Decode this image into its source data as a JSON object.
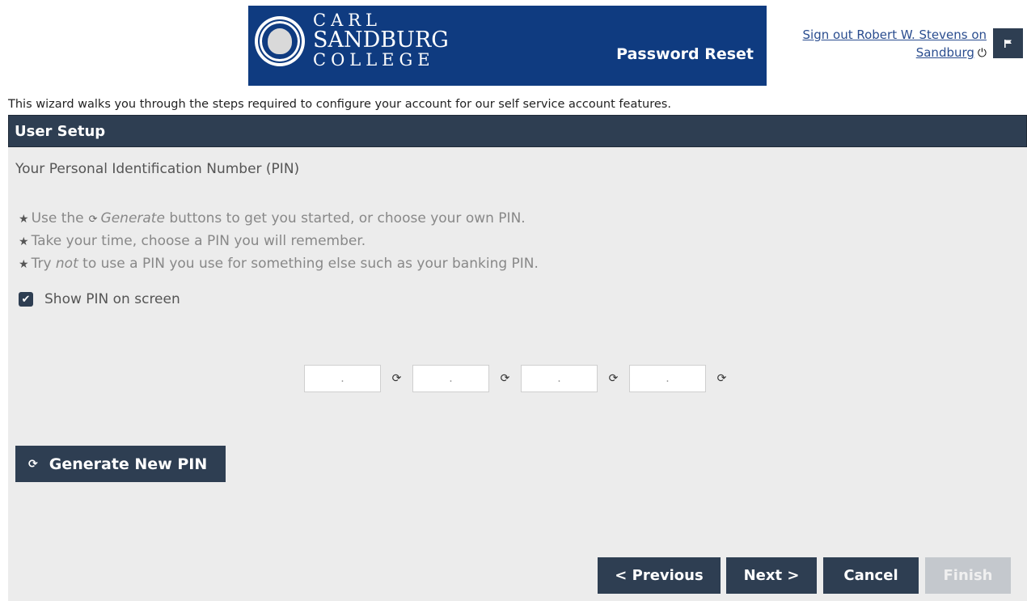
{
  "header": {
    "logo_line1": "CARL",
    "logo_line2": "SANDBURG",
    "logo_line3": "COLLEGE",
    "title": "Password Reset",
    "signout_text": "Sign out Robert W. Stevens on Sandburg",
    "power_icon": "power-icon",
    "flag_icon": "flag-icon"
  },
  "intro": "This wizard walks you through the steps required to configure your account for our self service account features.",
  "panel": {
    "header": "User Setup",
    "section_title": "Your Personal Identification Number (PIN)",
    "tips": [
      {
        "before": "Use the",
        "italic": "Generate",
        "after": "buttons to get you started, or choose your own PIN."
      },
      {
        "before": "Take your time, choose a PIN you will remember.",
        "italic": "",
        "after": ""
      },
      {
        "before": "Try",
        "italic": "not",
        "after": "to use a PIN you use for something else such as your banking PIN."
      }
    ],
    "show_pin_label": "Show PIN on screen",
    "show_pin_checked": true,
    "pin_boxes": [
      {
        "value": "."
      },
      {
        "value": "."
      },
      {
        "value": "."
      },
      {
        "value": "."
      }
    ],
    "generate_button": "Generate New PIN"
  },
  "nav": {
    "previous": "< Previous",
    "next": "Next >",
    "cancel": "Cancel",
    "finish": "Finish"
  },
  "colors": {
    "banner": "#0f3b80",
    "dark": "#2e3e52",
    "panel_bg": "#ececec",
    "disabled": "#c4c8cd"
  }
}
